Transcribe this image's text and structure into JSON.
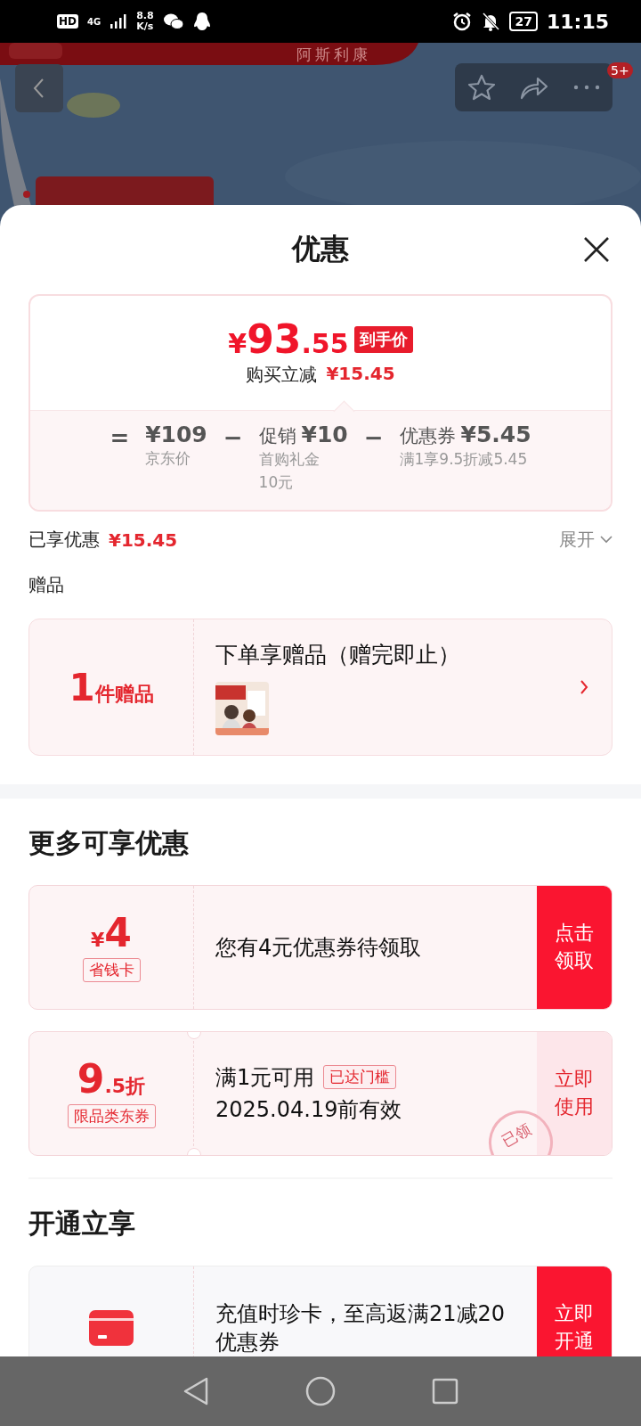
{
  "status_bar": {
    "hd": "HD",
    "network": "4G",
    "speed_value": "8.8",
    "speed_unit": "K/s",
    "battery": "27",
    "time": "11:15"
  },
  "background": {
    "kind": "picture",
    "brand_caption": "阿斯利康",
    "badge": "5+"
  },
  "sheet": {
    "title": "优惠",
    "price_card": {
      "currency": "¥",
      "integer": "93",
      "decimal": ".55",
      "tag": "到手价",
      "saving_label": "购买立减",
      "saving_amount": "¥15.45",
      "breakdown": [
        {
          "op": "=",
          "amount": "¥109",
          "note": [
            "京东价"
          ]
        },
        {
          "op": "−",
          "prefix": "促销",
          "amount": "¥10",
          "note": [
            "首购礼金",
            "10元"
          ]
        },
        {
          "op": "−",
          "prefix": "优惠券",
          "amount": "¥5.45",
          "note": [
            "满1享9.5折减5.45"
          ]
        }
      ]
    },
    "enjoyed": {
      "label": "已享优惠",
      "amount": "¥15.45",
      "toggle": "展开",
      "expanded": false
    },
    "gifts": {
      "heading": "赠品",
      "count": "1",
      "unit": "件赠品",
      "title": "下单享赠品（赠完即止）"
    },
    "more": {
      "heading": "更多可享优惠",
      "offers": [
        {
          "kind": "card",
          "currency": "¥",
          "value": "4",
          "tag": "省钱卡",
          "text": [
            "您有4元优惠券待领取"
          ],
          "action": "点击领取"
        },
        {
          "kind": "coupon",
          "value": "9",
          "suffix": ".5折",
          "tag": "限品类东券",
          "text": [
            "满1元可用",
            "2025.04.19前有效"
          ],
          "badge": "已达门槛",
          "stamp": "已领",
          "action": "立即使用"
        }
      ]
    },
    "open": {
      "heading": "开通立享",
      "offers": [
        {
          "kind": "membership",
          "text": [
            "充值时珍卡，至高返满21减20优惠券"
          ],
          "action": "立即开通"
        }
      ]
    }
  }
}
